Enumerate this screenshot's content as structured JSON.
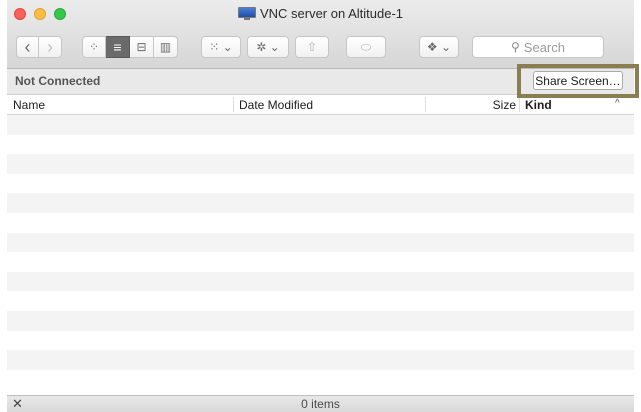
{
  "window": {
    "title": "VNC server on Altitude-1",
    "title_icon": "monitor-icon"
  },
  "toolbar": {
    "back": "‹",
    "forward": "›",
    "view_icons": "⁘",
    "view_list": "≡",
    "view_columns": "⊟",
    "view_coverflow": "▥",
    "arrange": "⁙ ⌄",
    "action": "✲ ⌄",
    "share": "⇧",
    "tag": "⬭",
    "dropbox": "❖ ⌄",
    "search_placeholder": "Search"
  },
  "connection": {
    "status": "Not Connected",
    "share_screen": "Share Screen…"
  },
  "columns": {
    "name": "Name",
    "date_modified": "Date Modified",
    "size": "Size",
    "kind": "Kind",
    "sort_indicator": "^"
  },
  "rows_count_visible": 14,
  "status": {
    "items": "0 items",
    "icon": "disconnect-icon"
  },
  "colors": {
    "highlight": "#8a7d52",
    "close": "#fc605c",
    "minimize": "#fdbc40",
    "maximize": "#34c84a"
  }
}
